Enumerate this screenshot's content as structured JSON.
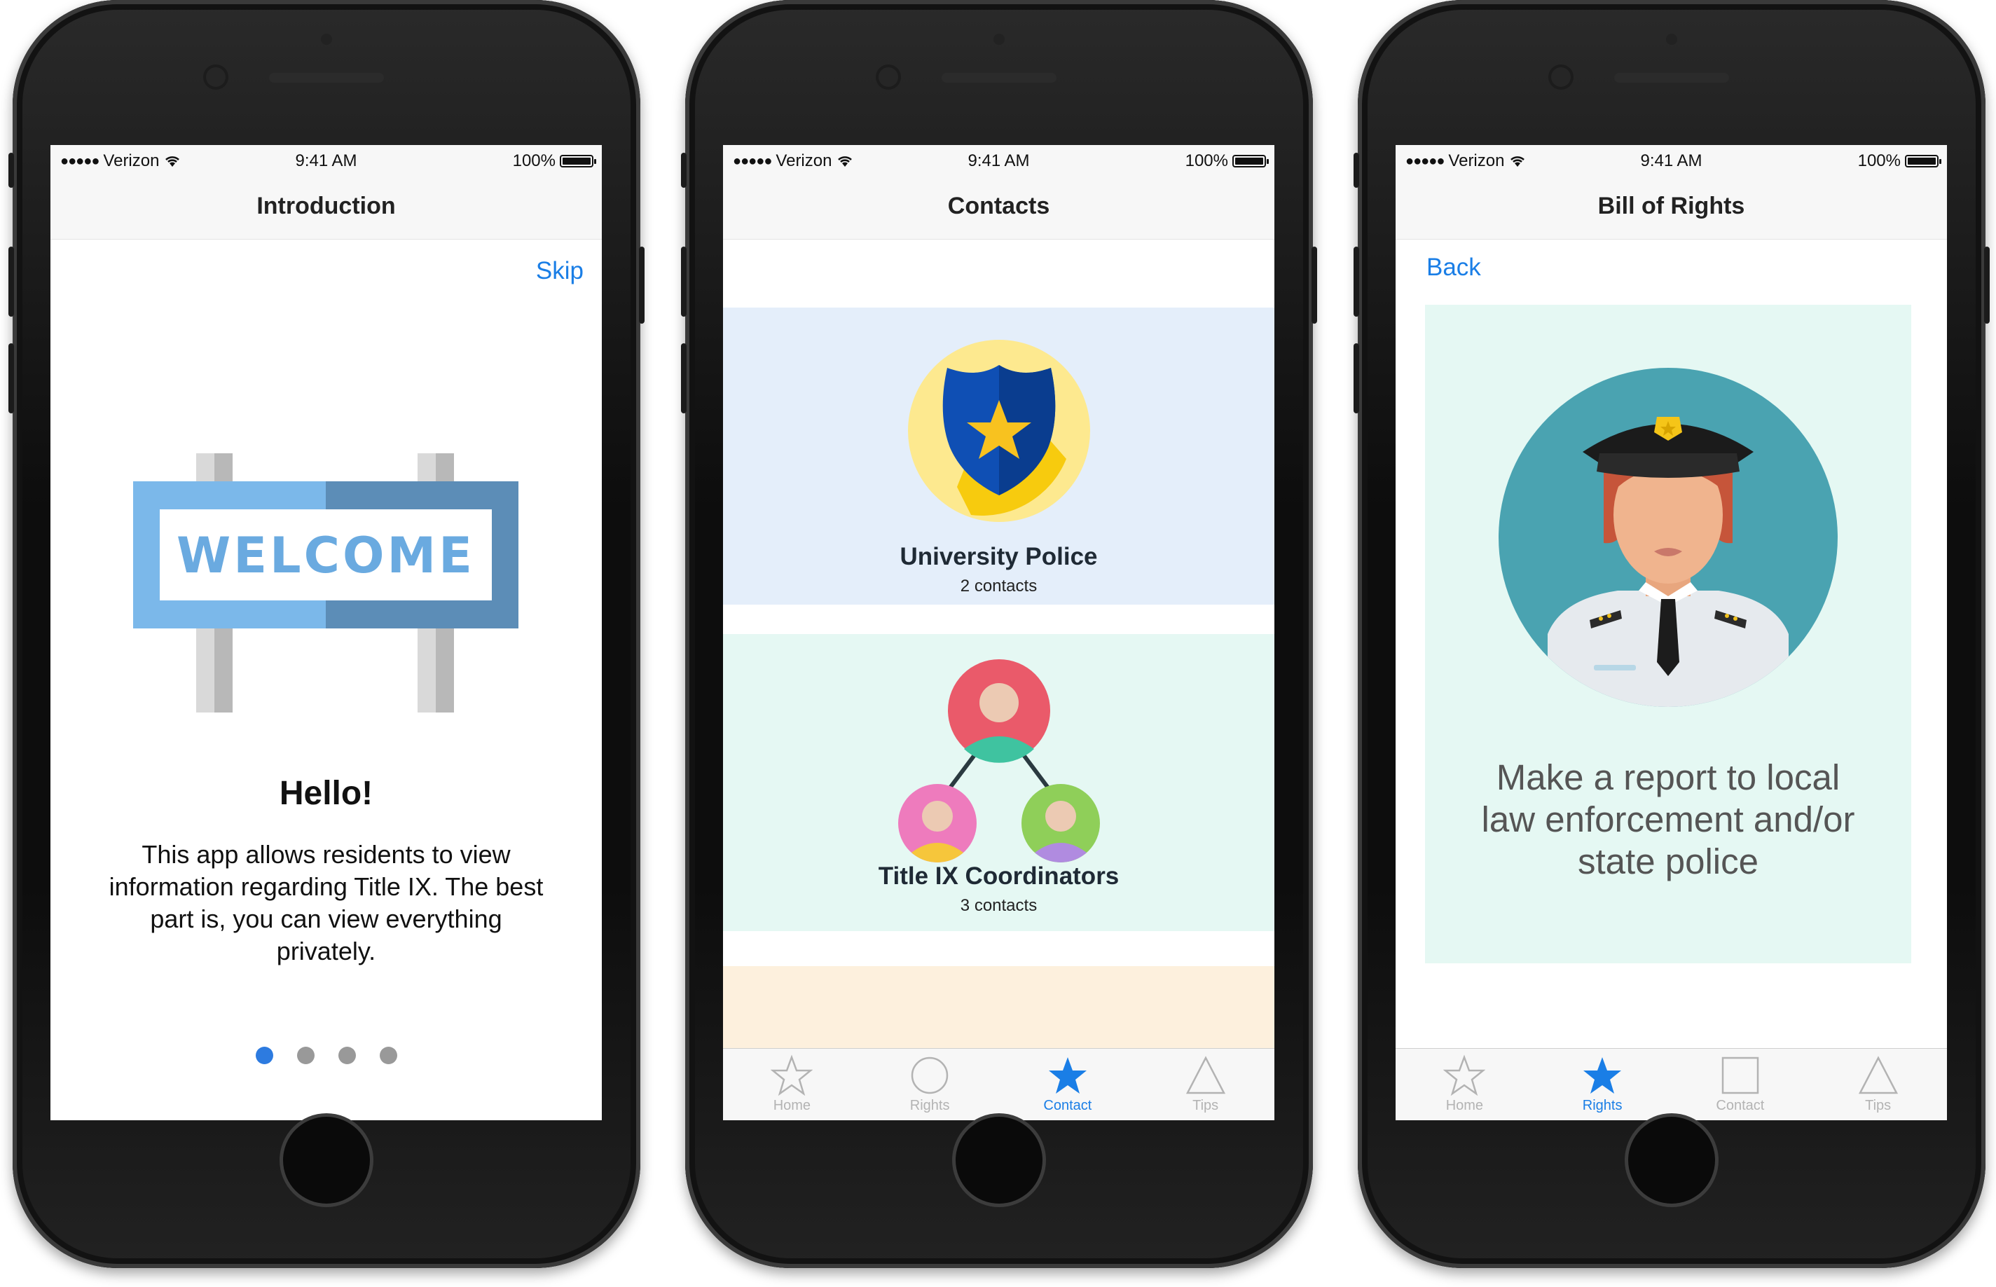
{
  "status_bar": {
    "carrier": "Verizon",
    "time": "9:41 AM",
    "battery": "100%"
  },
  "screen1": {
    "title": "Introduction",
    "skip_label": "Skip",
    "sign_text": "WELCOME",
    "heading": "Hello!",
    "body": "This app allows residents to view information regarding Title IX. The best part is, you can view everything privately.",
    "pager": {
      "count": 4,
      "active_index": 0
    }
  },
  "screen2": {
    "title": "Contacts",
    "cards": [
      {
        "title": "University Police",
        "subtitle": "2 contacts",
        "bg": "#e4eefa"
      },
      {
        "title": "Title IX Coordinators",
        "subtitle": "3 contacts",
        "bg": "#e5f8f3"
      },
      {
        "title": "",
        "subtitle": "",
        "bg": "#fdf0dd"
      }
    ],
    "tabs": [
      {
        "label": "Home",
        "icon": "star-outline-icon",
        "active": false
      },
      {
        "label": "Rights",
        "icon": "circle-outline-icon",
        "active": false
      },
      {
        "label": "Contact",
        "icon": "star-filled-icon",
        "active": true
      },
      {
        "label": "Tips",
        "icon": "triangle-outline-icon",
        "active": false
      }
    ]
  },
  "screen3": {
    "title": "Bill of Rights",
    "back_label": "Back",
    "message": "Make a report to local law enforcement and/or state police",
    "tabs": [
      {
        "label": "Home",
        "icon": "star-outline-icon",
        "active": false
      },
      {
        "label": "Rights",
        "icon": "star-filled-icon",
        "active": true
      },
      {
        "label": "Contact",
        "icon": "square-outline-icon",
        "active": false
      },
      {
        "label": "Tips",
        "icon": "triangle-outline-icon",
        "active": false
      }
    ]
  },
  "colors": {
    "accent": "#1a7ee6",
    "inactive_tab": "#b3b3b3",
    "pager_active": "#2d7be0",
    "rights_card_bg": "#e5f8f3"
  }
}
